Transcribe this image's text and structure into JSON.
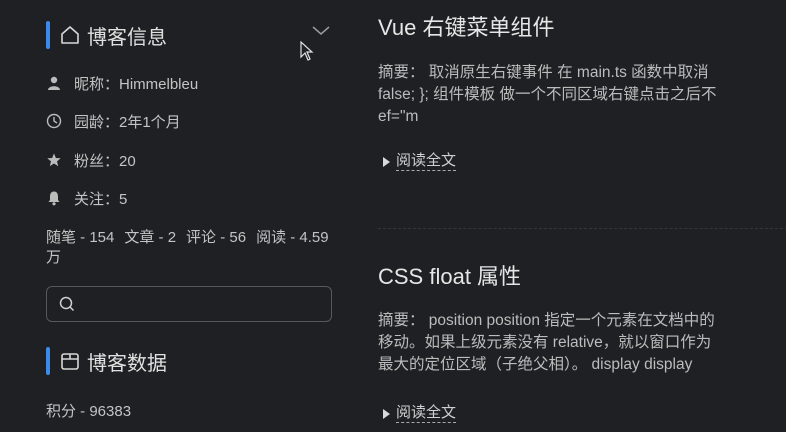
{
  "blog_info": {
    "title": "博客信息",
    "nickname": "昵称：Himmelbleu",
    "age": "园龄：2年1个月",
    "fans": "粉丝：20",
    "following": "关注：5",
    "stats": [
      "随笔 - 154",
      "文章 - 2",
      "评论 - 56",
      "阅读 - 4.59万"
    ]
  },
  "search": {
    "placeholder": ""
  },
  "blog_data": {
    "title": "博客数据",
    "score": "积分 - 96383"
  },
  "posts": [
    {
      "title": "Vue 右键菜单组件",
      "summary_lines": [
        "摘要：  取消原生右键事件 在 main.ts 函数中取消",
        "false; }; 组件模板 做一个不同区域右键点击之后不",
        "ef=\"m"
      ],
      "read_more": "阅读全文"
    },
    {
      "title": "CSS float 属性",
      "summary_lines": [
        "摘要：  position position 指定一个元素在文档中的",
        "移动。如果上级元素没有 relative，就以窗口作为",
        "最大的定位区域（子绝父相）。 display display"
      ],
      "read_more": "阅读全文"
    }
  ],
  "colors": {
    "accent": "#3b8beb",
    "background": "#1f2023"
  }
}
